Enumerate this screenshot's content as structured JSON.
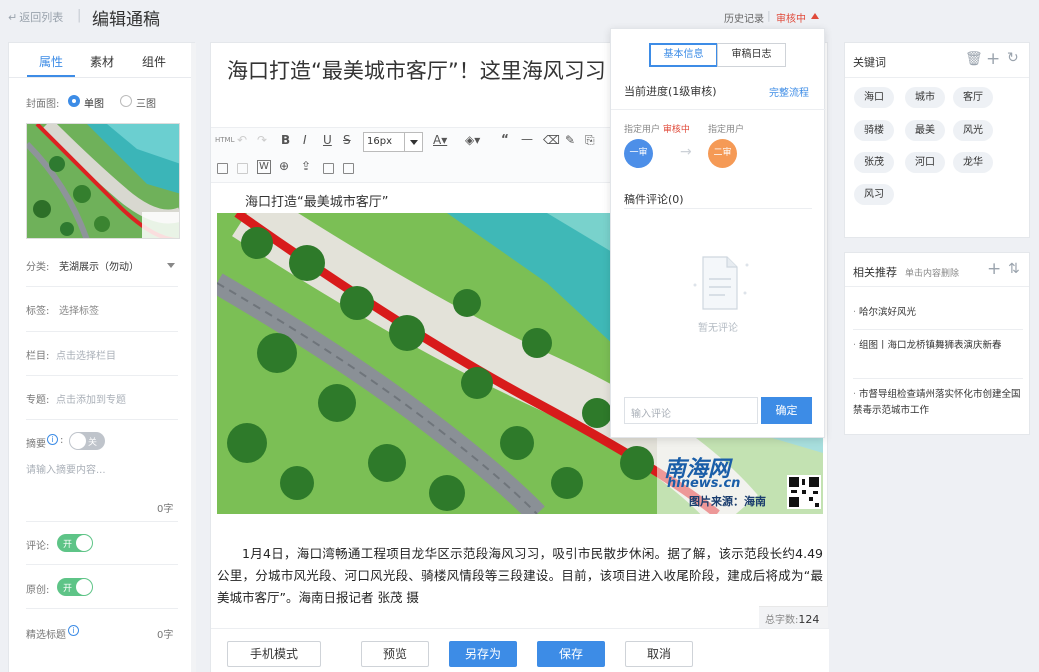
{
  "topbar": {
    "back_label": "返回列表",
    "page_title": "编辑通稿",
    "history_label": "历史记录",
    "status_label": "审核中"
  },
  "left": {
    "tabs": [
      "属性",
      "素材",
      "组件"
    ],
    "cover_label": "封面图:",
    "cover_single": "单图",
    "cover_triple": "三图",
    "category_label": "分类:",
    "category_value": "芜湖展示（勿动）",
    "tags_label": "标签:",
    "tags_placeholder": "选择标签",
    "column_label": "栏目:",
    "column_placeholder": "点击选择栏目",
    "topic_label": "专题:",
    "topic_placeholder": "点击添加到专题",
    "summary_label": "摘要",
    "summary_toggle": "关",
    "summary_placeholder": "请输入摘要内容...",
    "summary_count": "0字",
    "comment_label": "评论:",
    "comment_toggle": "开",
    "original_label": "原创:",
    "original_toggle": "开",
    "featured_title_label": "精选标题",
    "featured_count": "0字"
  },
  "editor": {
    "title": "海口打造“最美城市客厅”！这里海风习习",
    "font_size": "16px",
    "subtitle": "海口打造“最美城市客厅”",
    "watermark_brand": "南海网",
    "watermark_domain": "hinews.cn",
    "watermark_source": "图片来源：海南",
    "body": "1月4日，海口湾畅通工程项目龙华区示范段海风习习，吸引市民散步休闲。据了解，该示范段长约4.49公里，分城市风光段、河口风光段、骑楼风情段等三段建设。目前，该项目进入收尾阶段，建成后将成为“最美城市客厅”。海南日报记者 张茂 摄",
    "wordcount_label": "总字数:",
    "wordcount_value": "124",
    "buttons": {
      "mobile": "手机模式",
      "preview": "预览",
      "save_as": "另存为",
      "save": "保存",
      "cancel": "取消"
    }
  },
  "popup": {
    "tab_basic": "基本信息",
    "tab_log": "审稿日志",
    "progress": "当前进度(1级审核)",
    "full_flow": "完整流程",
    "user1_label": "指定用户",
    "user1_status": "审核中",
    "user2_label": "指定用户",
    "step1": "一审",
    "step2": "二审",
    "comments_title": "稿件评论(0)",
    "no_comments": "暂无评论",
    "input_placeholder": "输入评论",
    "confirm": "确定"
  },
  "keywords": {
    "title": "关键词",
    "tags": [
      "海口",
      "城市",
      "客厅",
      "骑楼",
      "最美",
      "风光",
      "张茂",
      "河口",
      "龙华",
      "风习"
    ]
  },
  "related": {
    "title": "相关推荐",
    "hint": "单击内容删除",
    "items": [
      "哈尔滨好风光",
      "组图丨海口龙桥镇舞狮表演庆新春",
      "市督导组检查靖州落实怀化市创建全国禁毒示范城市工作"
    ]
  },
  "colors": {
    "accent": "#3d8ce6",
    "status_red": "#e04a3a",
    "toggle_green": "#5ec487",
    "step1_blue": "#4d8fe8",
    "step2_orange": "#f59a56"
  }
}
